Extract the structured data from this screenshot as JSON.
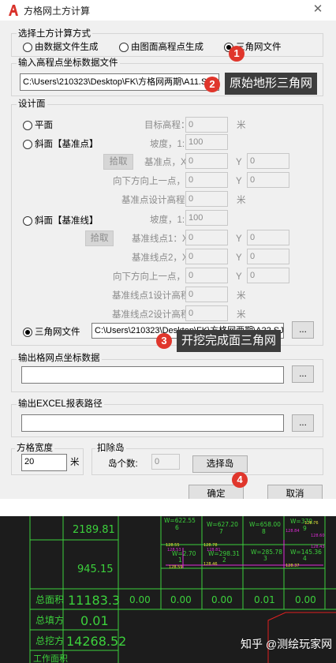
{
  "window": {
    "title": "方格网土方计算"
  },
  "method_group": {
    "title": "选择土方计算方式",
    "options": [
      {
        "label": "由数据文件生成",
        "selected": false
      },
      {
        "label": "由图面高程点生成",
        "selected": false
      },
      {
        "label": "三角网文件",
        "selected": true
      }
    ]
  },
  "input_file": {
    "title": "输入高程点坐标数据文件",
    "value": "C:\\Users\\210323\\Desktop\\FK\\方格网两期\\A11.SJW"
  },
  "design": {
    "title": "设计面",
    "plane": {
      "label": "平面",
      "target_label": "目标高程：",
      "target_value": "0",
      "unit": "米"
    },
    "slope_point": {
      "label": "斜面【基准点】",
      "slope_label": "坡度，1:",
      "slope_value": "100",
      "pick_label": "拾取",
      "base_x_label": "基准点，X",
      "base_x": "0",
      "base_y": "0",
      "down_x_label": "向下方向上一点，X",
      "down_x": "0",
      "down_y": "0",
      "design_elev_label": "基准点设计高程：",
      "design_elev": "0",
      "unit": "米"
    },
    "slope_line": {
      "label": "斜面【基准线】",
      "slope_label": "坡度，1:",
      "slope_value": "100",
      "pick_label": "拾取",
      "p1_label": "基准线点1：X",
      "p1_x": "0",
      "p1_y": "0",
      "p2_label": "基准线点2，X",
      "p2_x": "0",
      "p2_y": "0",
      "down_label": "向下方向上一点，X",
      "down_x": "0",
      "down_y": "0",
      "elev1_label": "基准线点1设计高程：",
      "elev1": "0",
      "elev2_label": "基准线点2设计高程：",
      "elev2": "0",
      "unit": "米"
    },
    "tin": {
      "label": "三角网文件",
      "value": "C:\\Users\\210323\\Desktop\\FK\\方格网两期\\A22.SJW",
      "browse": "..."
    },
    "y_label": "Y"
  },
  "output_grid": {
    "title": "输出格网点坐标数据",
    "value": "",
    "browse": "..."
  },
  "output_excel": {
    "title": "输出EXCEL报表路径",
    "value": "",
    "browse": "..."
  },
  "grid_width": {
    "title": "方格宽度",
    "value": "20",
    "unit": "米"
  },
  "islands": {
    "title": "扣除岛",
    "count_label": "岛个数:",
    "count_value": "0",
    "select_label": "选择岛"
  },
  "actions": {
    "ok": "确定",
    "cancel": "取消"
  },
  "annotations": {
    "badge_1": "1",
    "badge_2": "2",
    "badge_3": "3",
    "badge_4": "4",
    "callout_2": "原始地形三角网",
    "callout_3": "开挖完成面三角网"
  },
  "cad": {
    "cells": [
      "2189.81",
      "945.15"
    ],
    "totals": [
      {
        "label": "总面积",
        "value": "11183.3"
      },
      {
        "label": "总填方",
        "value": "0.01"
      },
      {
        "label": "总挖方",
        "value": "14268.52"
      },
      {
        "label": "工作面积",
        "value": ""
      }
    ],
    "row_values": [
      "0.00",
      "0.00",
      "0.00",
      "0.01",
      "0.00"
    ],
    "grid_labels": [
      {
        "w": "W=622.55",
        "n": "6"
      },
      {
        "w": "W=627.20",
        "n": "7"
      },
      {
        "w": "W=658.00",
        "n": "8"
      },
      {
        "w": "W=370.",
        "n": "9"
      }
    ],
    "inner_labels": [
      {
        "w": "W=2.70",
        "n": "1"
      },
      {
        "w": "W=298.31",
        "n": "2"
      },
      {
        "w": "W=285.78",
        "n": "3"
      },
      {
        "w": "W=145.36",
        "n": "4"
      }
    ],
    "small_values": [
      "128.76",
      "128.55",
      "128.78",
      "128.53",
      "128.81",
      "128.59",
      "128.46",
      "128.84",
      "128.60",
      "128.43",
      "128.37"
    ],
    "accent_colors": {
      "cad_bg": "#1c1c1c",
      "line": "#3cd13c",
      "text_green": "#3cd13c",
      "text_magenta": "#e02cd8",
      "text_yellow": "#e8e23a",
      "text_white": "#ffffff",
      "red_line": "#e02020"
    }
  },
  "watermark": "知乎 @测绘玩家网"
}
